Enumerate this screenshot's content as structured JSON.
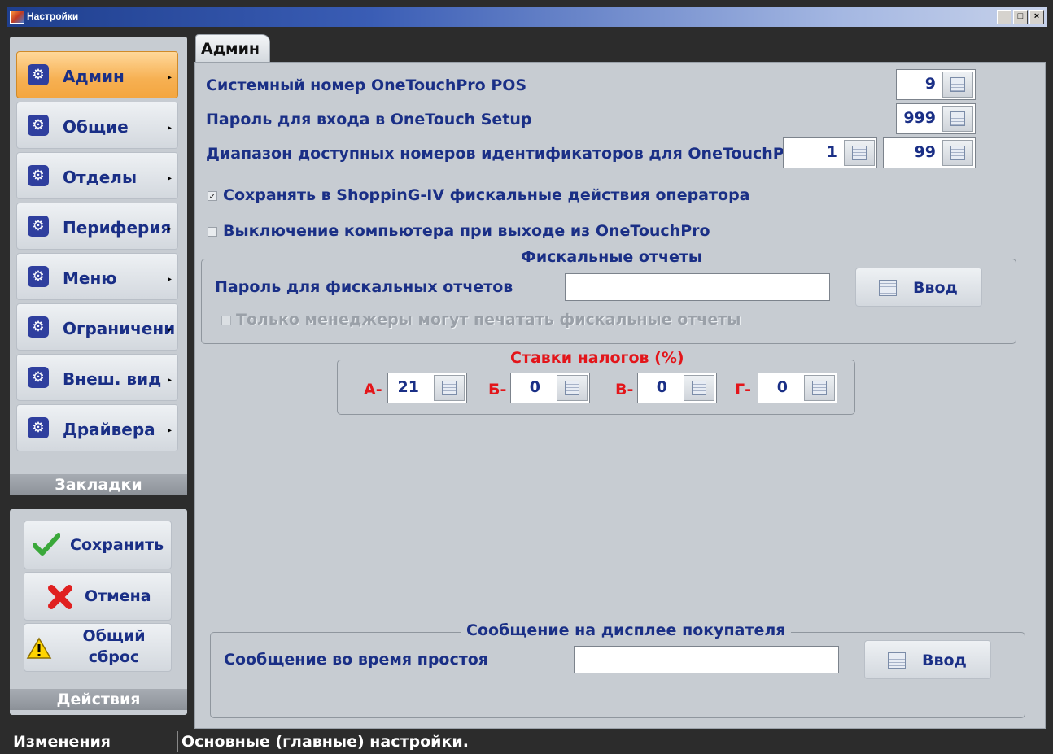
{
  "window": {
    "title": "Настройки",
    "min_label": "_",
    "max_label": "□",
    "close_label": "×"
  },
  "sidebar": {
    "items": [
      {
        "label": "Админ",
        "icon": "gear-icon",
        "active": true
      },
      {
        "label": "Общие",
        "icon": "gear-icon"
      },
      {
        "label": "Отделы",
        "icon": "gear-icon"
      },
      {
        "label": "Периферия",
        "icon": "gear-icon"
      },
      {
        "label": "Меню",
        "icon": "gear-icon"
      },
      {
        "label": "Ограничени",
        "icon": "gear-icon"
      },
      {
        "label": "Внеш. вид",
        "icon": "gear-icon"
      },
      {
        "label": "Драйвера",
        "icon": "gear-icon"
      }
    ],
    "bookmarks_label": "Закладки",
    "actions": {
      "save_label": "Сохранить",
      "cancel_label": "Отмена",
      "reset_line1": "Общий",
      "reset_line2": "сброс",
      "group_label": "Действия"
    }
  },
  "tab": {
    "label": "Админ"
  },
  "admin": {
    "system_number_label": "Системный номер OneTouchPro POS",
    "system_number_value": "9",
    "setup_password_label": "Пароль для входа в OneTouch Setup",
    "setup_password_value": "999",
    "id_range_label": "Диапазон доступных номеров идентификаторов для OneTouchPro",
    "id_range_from": "1",
    "id_range_to": "99",
    "save_fiscal_label": "Сохранять в ShoppinG-IV фискальные действия оператора",
    "save_fiscal_checked": true,
    "shutdown_label": "Выключение компьютера при выходе из OneTouchPro",
    "shutdown_checked": false
  },
  "fiscal": {
    "legend": "Фискальные отчеты",
    "password_label": "Пароль для фискальных отчетов",
    "password_value": "",
    "enter_label": "Ввод",
    "managers_only_label": "Только менеджеры могут печатать фискальные отчеты",
    "managers_only_checked": false
  },
  "tax": {
    "legend": "Ставки налогов  (%)",
    "rates": [
      {
        "label": "А-",
        "value": "21"
      },
      {
        "label": "Б-",
        "value": "0"
      },
      {
        "label": "В-",
        "value": "0"
      },
      {
        "label": "Г-",
        "value": "0"
      }
    ]
  },
  "display": {
    "legend": "Сообщение на дисплее покупателя",
    "idle_label": "Сообщение во время простоя",
    "idle_value": "",
    "enter_label": "Ввод"
  },
  "status": {
    "left": "Изменения",
    "right": "Основные (главные) настройки."
  },
  "colors": {
    "label_blue": "#1a2f86",
    "tax_red": "#e3151a",
    "panel_gray": "#c7ccd2",
    "active_orange": "#f6b052"
  }
}
